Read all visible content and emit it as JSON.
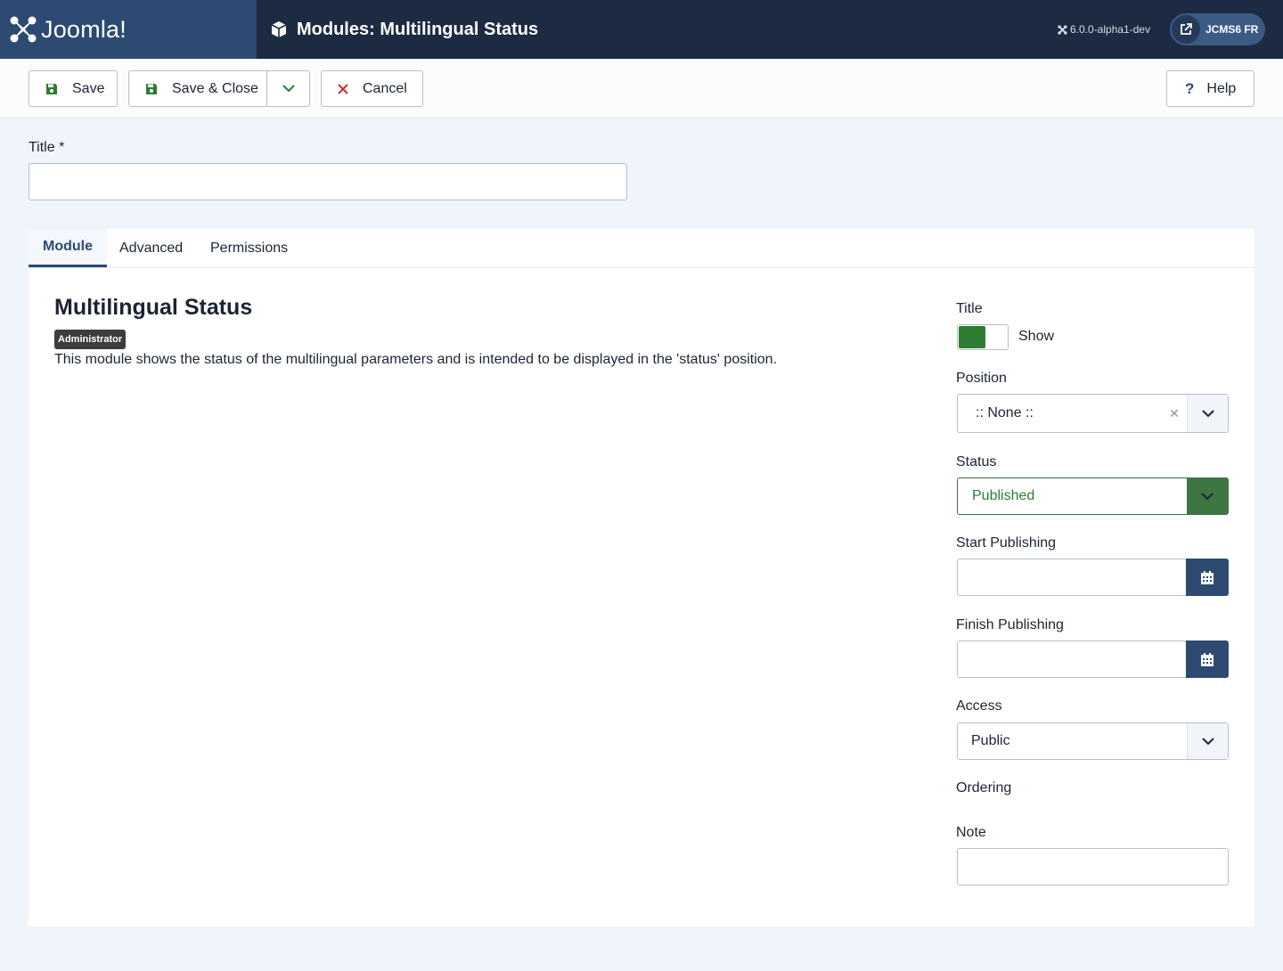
{
  "header": {
    "brand": "Joomla!",
    "page_title": "Modules: Multilingual Status",
    "version": "6.0.0-alpha1-dev",
    "site_button": "JCMS6 FR"
  },
  "toolbar": {
    "save_label": "Save",
    "save_close_label": "Save & Close",
    "cancel_label": "Cancel",
    "help_label": "Help"
  },
  "form": {
    "title_label": "Title *",
    "title_value": ""
  },
  "tabs": [
    {
      "label": "Module",
      "active": true
    },
    {
      "label": "Advanced",
      "active": false
    },
    {
      "label": "Permissions",
      "active": false
    }
  ],
  "module": {
    "name": "Multilingual Status",
    "badge": "Administrator",
    "description": "This module shows the status of the multilingual parameters and is intended to be displayed in the 'status' position."
  },
  "sidebar": {
    "title_label": "Title",
    "title_switch_text": "Show",
    "title_switch_on": true,
    "position_label": "Position",
    "position_value": ":: None ::",
    "status_label": "Status",
    "status_value": "Published",
    "start_label": "Start Publishing",
    "start_value": "",
    "finish_label": "Finish Publishing",
    "finish_value": "",
    "access_label": "Access",
    "access_value": "Public",
    "ordering_label": "Ordering",
    "note_label": "Note",
    "note_value": ""
  },
  "colors": {
    "header_bg": "#1c2b42",
    "logo_bg": "#2c4a72",
    "accent": "#2a4a78",
    "published_green": "#2e7d32",
    "cancel_red": "#c62828"
  }
}
